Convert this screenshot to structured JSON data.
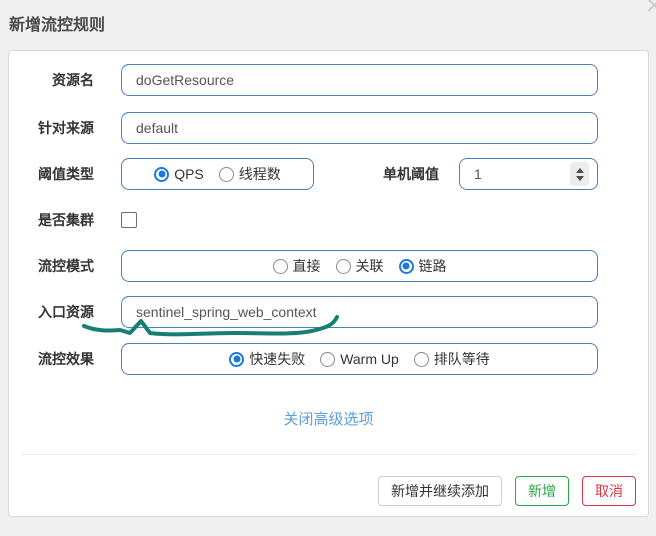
{
  "dialog": {
    "title": "新增流控规则",
    "close_icon": "×"
  },
  "form": {
    "resource": {
      "label": "资源名",
      "value": "doGetResource"
    },
    "limit_app": {
      "label": "针对来源",
      "value": "default"
    },
    "grade": {
      "label": "阈值类型",
      "options": [
        {
          "label": "QPS",
          "selected": true
        },
        {
          "label": "线程数",
          "selected": false
        }
      ]
    },
    "threshold": {
      "label": "单机阈值",
      "value": "1"
    },
    "cluster": {
      "label": "是否集群",
      "checked": false
    },
    "strategy": {
      "label": "流控模式",
      "options": [
        {
          "label": "直接",
          "selected": false
        },
        {
          "label": "关联",
          "selected": false
        },
        {
          "label": "链路",
          "selected": true
        }
      ]
    },
    "ref_resource": {
      "label": "入口资源",
      "value": "sentinel_spring_web_context"
    },
    "behavior": {
      "label": "流控效果",
      "options": [
        {
          "label": "快速失败",
          "selected": true
        },
        {
          "label": "Warm Up",
          "selected": false
        },
        {
          "label": "排队等待",
          "selected": false
        }
      ]
    }
  },
  "advanced_toggle": {
    "label": "关闭高级选项"
  },
  "footer": {
    "add_and_continue": "新增并继续添加",
    "add": "新增",
    "cancel": "取消"
  },
  "colors": {
    "input_border": "#4682b8",
    "radio_selected": "#1b79dd",
    "link": "#5b9fd8",
    "add_button": "#28a745",
    "cancel_button": "#dc3545",
    "annotation": "#177f72"
  }
}
